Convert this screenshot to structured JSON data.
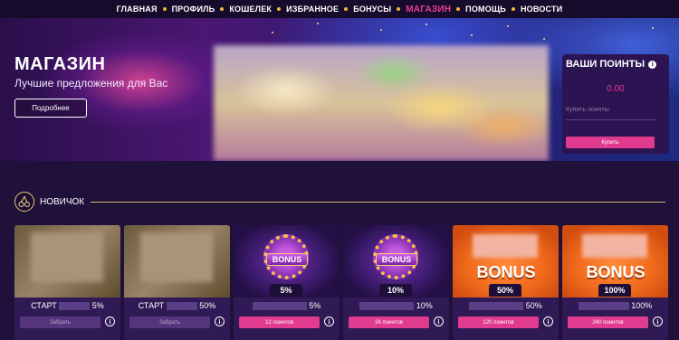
{
  "nav": {
    "items": [
      {
        "label": "ГЛАВНАЯ",
        "active": false
      },
      {
        "label": "ПРОФИЛЬ",
        "active": false
      },
      {
        "label": "КОШЕЛЕК",
        "active": false
      },
      {
        "label": "ИЗБРАННОЕ",
        "active": false
      },
      {
        "label": "БОНУСЫ",
        "active": false
      },
      {
        "label": "МАГАЗИН",
        "active": true
      },
      {
        "label": "ПОМОЩЬ",
        "active": false
      },
      {
        "label": "НОВОСТИ",
        "active": false
      }
    ]
  },
  "hero": {
    "title": "МАГАЗИН",
    "subtitle": "Лучшие предложения для Вас",
    "more_button": "Подробнее"
  },
  "points": {
    "title": "ВАШИ ПОИНТЫ",
    "info_icon": "i",
    "value": "0.00",
    "buy_label": "Купить поинты",
    "buy_button": "Купить"
  },
  "section": {
    "title": "НОВИЧОК",
    "icon": "cherries-icon"
  },
  "cards": [
    {
      "name": "СТАРТ",
      "pct": "5%",
      "button": "Забрать",
      "button_style": "muted",
      "style": "blur"
    },
    {
      "name": "СТАРТ",
      "pct": "50%",
      "button": "Забрать",
      "button_style": "muted",
      "style": "blur"
    },
    {
      "name": "",
      "pct": "5%",
      "badge": "BONUS",
      "tab": "5%",
      "button": "12 поинтов",
      "button_style": "pink",
      "style": "purple"
    },
    {
      "name": "",
      "pct": "10%",
      "badge": "BONUS",
      "tab": "10%",
      "button": "24 поинтов",
      "button_style": "pink",
      "style": "purple"
    },
    {
      "name": "",
      "pct": "50%",
      "badge": "BONUS",
      "tab": "50%",
      "button": "120 поинтов",
      "button_style": "pink",
      "style": "orange"
    },
    {
      "name": "",
      "pct": "100%",
      "badge": "BONUS",
      "tab": "100%",
      "button": "240 поинтов",
      "button_style": "pink",
      "style": "orange"
    }
  ],
  "colors": {
    "accent": "#e8399a",
    "background": "#20113a",
    "gold": "#d7b96b"
  }
}
